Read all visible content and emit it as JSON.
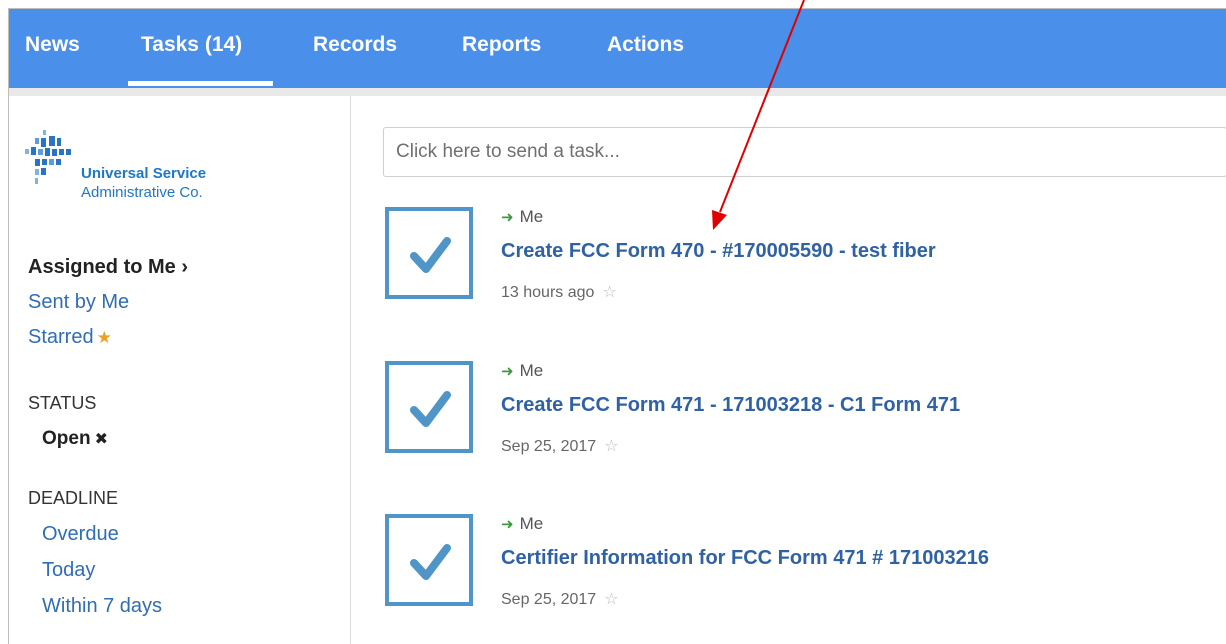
{
  "nav": {
    "items": [
      {
        "label": "News"
      },
      {
        "label": "Tasks (14)"
      },
      {
        "label": "Records"
      },
      {
        "label": "Reports"
      },
      {
        "label": "Actions"
      }
    ]
  },
  "logo": {
    "line1": "Universal Service",
    "line2": "Administrative Co."
  },
  "sidebar": {
    "assigned": "Assigned to Me ›",
    "sent": "Sent by Me",
    "starred": "Starred",
    "status_heading": "STATUS",
    "status_value": "Open",
    "deadline_heading": "DEADLINE",
    "deadline_items": [
      "Overdue",
      "Today",
      "Within 7 days"
    ]
  },
  "main": {
    "send_placeholder": "Click here to send a task...",
    "tasks": [
      {
        "assignee": "Me",
        "title": "Create FCC Form 470 - #170005590 - test fiber",
        "time": "13 hours ago"
      },
      {
        "assignee": "Me",
        "title": "Create FCC Form 471 - 171003218 - C1 Form 471",
        "time": "Sep 25, 2017"
      },
      {
        "assignee": "Me",
        "title": "Certifier Information for FCC Form 471 # 171003216",
        "time": "Sep 25, 2017"
      }
    ]
  },
  "colors": {
    "nav_bg": "#4a8fe9",
    "link": "#2f6db4",
    "task_title": "#2f62a5",
    "check": "#4f95c8",
    "annotation_arrow": "#e00000"
  },
  "icons": {
    "checkbox": "check-icon",
    "assignee": "arrow-right-icon",
    "star": "star-icon"
  }
}
